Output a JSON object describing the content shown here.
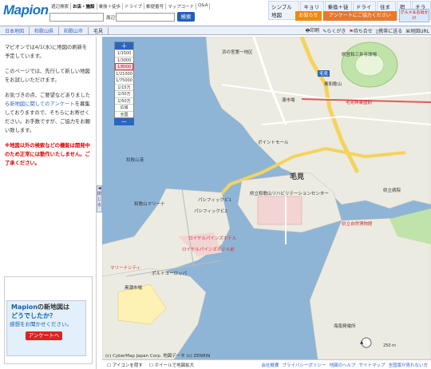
{
  "logo": "Mapion",
  "search": {
    "tabs": [
      "週辺検索",
      "お店・施設",
      "乗換＋徒歩",
      "ドライブ",
      "郵便番号",
      "マップコード",
      "Q&A"
    ],
    "near_label": "周辺で",
    "button": "検索"
  },
  "topnav": [
    "シンプル地図",
    "キョリ測",
    "乗換＋徒歩",
    "ドライブ",
    "住まい",
    "宿泊",
    "チラシ"
  ],
  "recommend": "お知らせ",
  "survey": "アンケートにご協力ください",
  "promo": "グルメ＆お出かけ",
  "breadcrumbs": [
    "日本地図",
    "和歌山県",
    "和歌山市",
    "毛見"
  ],
  "tools": [
    "印刷",
    "らくがき",
    "待ち合せ",
    "携帯に送る",
    "地図URL"
  ],
  "left": {
    "p1": "マピオンでは4/1(水)に地図の刷新を予定しています。",
    "p2": "このページでは、先行して新しい地図をお試しいただけます。",
    "p3a": "お気づきの点、ご要望などありましたら",
    "p3link": "新地図に関してのアンケート",
    "p3b": "を募集しておりますので、そちらにお寄せください。お手数ですが、ご協力をお願い致します。",
    "warn": "※地図以外の検索などの機能は開発中のため正常には動作いたしません。ご了承ください。",
    "collapse": "閉じる"
  },
  "ad": {
    "title1": "Mapion",
    "title2": "の新地図は",
    "title3": "どうでしたか？",
    "sub": "感想をお聞かせください。",
    "button": "アンケートへ"
  },
  "zoom": {
    "plus": "＋",
    "minus": "－",
    "levels": [
      "1/1500",
      "1/3000",
      "1/8000",
      "1/21000",
      "1/75000",
      "1/15万",
      "1/30万",
      "1/50万",
      "広域",
      "全国"
    ],
    "selected": 2
  },
  "map_labels": {
    "kemi": "毛見",
    "hama_ichi": "浜の宮第一地区",
    "ryokuchi": "県営和三井寺球場",
    "higashi": "東和歌山",
    "ichiba": "湊市場",
    "kemi_ken": "毛見",
    "sangyo": "毛見興業園前",
    "point_mall": "ポイントモール",
    "kemi_port": "和歌山港",
    "marina": "和歌山マリーナ",
    "pacific2": "パシフィックビ2",
    "pacific": "パシフィックビ1",
    "rehab": "県立和歌山リハビリテーションセンター",
    "hospital": "県立病院",
    "port_mall": "ポルトヨーロッパ",
    "marina_city": "マリーナシティ",
    "royal": "ロイヤルパインズホテル",
    "lake": "海南発電所",
    "hotel2": "ロイヤルパインズホテル前",
    "kuro": "黒潮市場",
    "ken_koen": "県立自然博物館",
    "shinmeido": "和歌山港"
  },
  "copyright": "(c) CyberMap Japan Corp. 地図データ (c) ZENRIN",
  "scale": "250 m",
  "footer": {
    "check1": "アイコンを隠す",
    "check2": "ホイールで地図拡大",
    "links": [
      "会社概要",
      "プライバシーポリシー",
      "地図のヘルプ",
      "サイトマップ",
      "全国版が見れない方"
    ]
  }
}
